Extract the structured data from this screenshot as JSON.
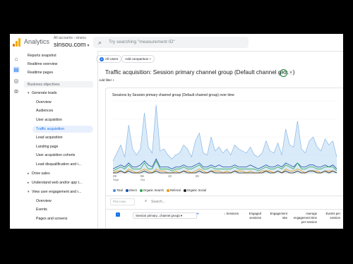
{
  "app": {
    "title": "Analytics",
    "account_crumb": "All accounts › sinsou",
    "property": "sinsou.com"
  },
  "search": {
    "placeholder": "Try searching \"measurement ID\""
  },
  "sidebar": {
    "items": [
      {
        "label": "Reports snapshot"
      },
      {
        "label": "Realtime overview"
      },
      {
        "label": "Realtime pages"
      },
      {
        "label": "Business objectives"
      },
      {
        "label": "Generate leads"
      },
      {
        "label": "Overview"
      },
      {
        "label": "Audiences"
      },
      {
        "label": "User acquisition"
      },
      {
        "label": "Traffic acquisition"
      },
      {
        "label": "Lead acquisition"
      },
      {
        "label": "Landing page"
      },
      {
        "label": "User acquisition cohorts"
      },
      {
        "label": "Lead disqualification and i..."
      },
      {
        "label": "Drive sales"
      },
      {
        "label": "Understand web and/or app t..."
      },
      {
        "label": "View user engagement and r..."
      },
      {
        "label": "Overview"
      },
      {
        "label": "Events"
      },
      {
        "label": "Pages and screens"
      }
    ]
  },
  "comparison": {
    "all_users": "All Users",
    "avatar": "A",
    "add_comparison": "Add comparison",
    "add_filter": "Add filter"
  },
  "page": {
    "title": "Traffic acquisition: Session primary channel group (Default channel group)"
  },
  "card": {
    "title": "Sessions by Session primary channel group (Default channel group) over time"
  },
  "chart_data": {
    "type": "line",
    "x": [
      "2024-09-01",
      "2024-09-02",
      "2024-09-03",
      "2024-09-04",
      "2024-09-05",
      "2024-09-06",
      "2024-09-07",
      "2024-09-08",
      "2024-09-09",
      "2024-09-10",
      "2024-09-11",
      "2024-09-12",
      "2024-09-13",
      "2024-09-14",
      "2024-09-15",
      "2024-09-16",
      "2024-09-17",
      "2024-09-18",
      "2024-09-19",
      "2024-09-20",
      "2024-09-21",
      "2024-09-22",
      "2024-09-23",
      "2024-09-24",
      "2024-09-25",
      "2024-09-26",
      "2024-09-27",
      "2024-09-28",
      "2024-09-29",
      "2024-09-30",
      "2024-10-01",
      "2024-10-02",
      "2024-10-03",
      "2024-10-04",
      "2024-10-05",
      "2024-10-06",
      "2024-10-07",
      "2024-10-08",
      "2024-10-09",
      "2024-10-10",
      "2024-10-11",
      "2024-10-12",
      "2024-10-13",
      "2024-10-14",
      "2024-10-15",
      "2024-10-16",
      "2024-10-17",
      "2024-10-18",
      "2024-10-19",
      "2024-10-20",
      "2024-10-21",
      "2024-10-22",
      "2024-10-23",
      "2024-10-24",
      "2024-10-25",
      "2024-10-26",
      "2024-10-27",
      "2024-10-28"
    ],
    "x_tick_labels": [
      {
        "label": "29",
        "sub": "Sept",
        "index": 0
      },
      {
        "label": "06",
        "sub": "Oct",
        "index": 7
      },
      {
        "label": "13",
        "sub": "",
        "index": 14
      },
      {
        "label": "20",
        "sub": "",
        "index": 21
      }
    ],
    "series": [
      {
        "name": "Total",
        "color": "#4a90d9",
        "values": [
          6,
          10,
          14,
          8,
          24,
          12,
          9,
          12,
          30,
          13,
          10,
          34,
          11,
          12,
          9,
          7,
          9,
          10,
          14,
          12,
          8,
          16,
          20,
          10,
          9,
          18,
          11,
          13,
          10,
          12,
          9,
          14,
          12,
          11,
          10,
          13,
          9,
          8,
          10,
          16,
          11,
          10,
          15,
          9,
          22,
          14,
          13,
          26,
          12,
          10,
          16,
          18,
          13,
          11,
          17,
          14,
          16,
          8
        ]
      },
      {
        "name": "Direct",
        "color": "#174ea6",
        "values": [
          2,
          3,
          4,
          3,
          5,
          3,
          3,
          4,
          6,
          4,
          3,
          7,
          3,
          3,
          3,
          2,
          3,
          3,
          4,
          3,
          3,
          4,
          5,
          3,
          3,
          4,
          3,
          4,
          3,
          3,
          3,
          4,
          3,
          3,
          3,
          4,
          3,
          2,
          3,
          4,
          3,
          3,
          4,
          3,
          5,
          4,
          3,
          5,
          3,
          3,
          4,
          4,
          3,
          3,
          4,
          3,
          4,
          2
        ]
      },
      {
        "name": "Organic Search",
        "color": "#34a853",
        "values": [
          1,
          2,
          3,
          2,
          4,
          2,
          2,
          2,
          5,
          2,
          2,
          6,
          2,
          2,
          2,
          1,
          2,
          2,
          3,
          2,
          2,
          3,
          4,
          2,
          2,
          3,
          2,
          2,
          2,
          2,
          2,
          3,
          2,
          2,
          2,
          2,
          2,
          1,
          2,
          3,
          2,
          2,
          3,
          2,
          4,
          3,
          2,
          5,
          2,
          2,
          3,
          3,
          2,
          2,
          3,
          3,
          3,
          1
        ]
      },
      {
        "name": "Referral",
        "color": "#f29900",
        "values": [
          0,
          1,
          1,
          0,
          2,
          1,
          0,
          1,
          2,
          1,
          0,
          2,
          1,
          1,
          0,
          0,
          1,
          0,
          1,
          1,
          0,
          1,
          2,
          1,
          0,
          1,
          1,
          1,
          0,
          1,
          0,
          1,
          1,
          1,
          0,
          1,
          0,
          0,
          1,
          1,
          1,
          0,
          1,
          0,
          2,
          1,
          1,
          2,
          1,
          0,
          1,
          1,
          1,
          0,
          1,
          1,
          1,
          0
        ]
      },
      {
        "name": "Organic Social",
        "color": "#202124",
        "values": [
          0,
          0,
          1,
          0,
          1,
          0,
          0,
          0,
          1,
          0,
          0,
          1,
          0,
          0,
          0,
          0,
          0,
          0,
          1,
          0,
          0,
          0,
          1,
          0,
          0,
          1,
          0,
          0,
          0,
          0,
          0,
          1,
          0,
          0,
          0,
          0,
          0,
          0,
          0,
          1,
          0,
          0,
          1,
          0,
          1,
          0,
          0,
          1,
          0,
          0,
          1,
          1,
          0,
          0,
          1,
          0,
          1,
          0
        ]
      }
    ],
    "ylim": [
      0,
      36
    ],
    "grid": true,
    "legend_placement": "bottom-left"
  },
  "table": {
    "plot_rows": "Plot rows",
    "search_placeholder": "Search...",
    "dimension": "Session primary...channel group)",
    "columns": [
      "↓ Sessions",
      "Engaged sessions",
      "Engagement rate",
      "Average engagement time per session",
      "Events per session"
    ]
  }
}
